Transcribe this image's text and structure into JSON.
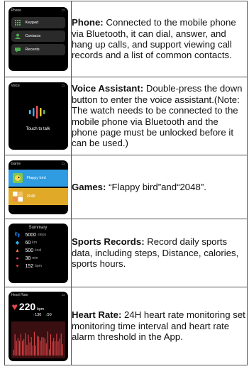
{
  "rows": [
    {
      "title": "Phone:",
      "body": "Connected to the mobile phone via Bluetooth, it can dial, answer, and hang up calls, and support viewing call records and a list of common contacts.",
      "screen": {
        "status": "Phone",
        "items": [
          "Keypad",
          "Contacts",
          "Recents"
        ]
      }
    },
    {
      "title": "Voice Assistant:",
      "body": "Double-press the down button to enter the voice assistant.(Note: The watch needs to be connected to the mobile phone via Bluetooth and the phone page must be unlocked before it can be used.)",
      "screen": {
        "status": "Voice",
        "caption": "Touch to talk"
      }
    },
    {
      "title": "Games:",
      "body": "“Flappy bird”and“2048”.",
      "screen": {
        "status": "Game",
        "items": [
          "Flappy bird",
          "2048"
        ]
      }
    },
    {
      "title": "Sports Records:",
      "body": "Record daily sports data, including steps, Distance, calories, sports hours.",
      "screen": {
        "header": "Summary",
        "stats": [
          {
            "value": "5000",
            "unit": "steps"
          },
          {
            "value": "60",
            "unit": "km"
          },
          {
            "value": "500",
            "unit": "kcal"
          },
          {
            "value": "38",
            "unit": "min"
          },
          {
            "value": "152",
            "unit": "bpm"
          }
        ]
      }
    },
    {
      "title": "Heart Rate:",
      "body": "24H heart rate monitoring set monitoring time interval and heart rate alarm threshold in the App.",
      "screen": {
        "status": "Heart Rate",
        "bpm": "220",
        "unit": "bpm",
        "high": "130",
        "low": "50"
      }
    }
  ],
  "colors": {
    "border": "#555555",
    "text": "#111111",
    "game_blue": "#2f9be0",
    "game_yellow": "#e0a928",
    "heart": "#e8484a"
  }
}
